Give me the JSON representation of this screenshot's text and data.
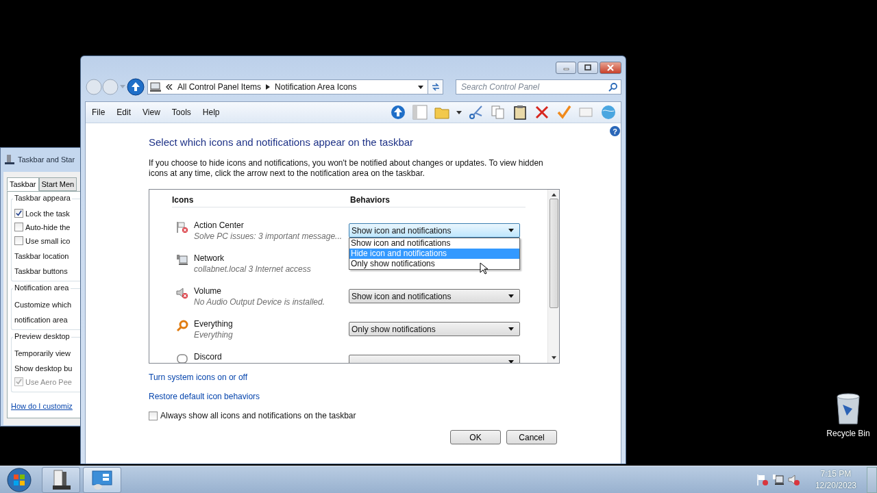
{
  "background_window": {
    "title": "Taskbar and Star",
    "tabs": [
      {
        "label": "Taskbar",
        "selected": true
      },
      {
        "label": "Start Men",
        "selected": false
      }
    ],
    "groups": [
      {
        "title": "Taskbar appeara",
        "items": [
          {
            "kind": "checkbox",
            "label": "Lock the task",
            "checked": true,
            "disabled": false
          },
          {
            "kind": "checkbox",
            "label": "Auto-hide the",
            "checked": false,
            "disabled": false
          },
          {
            "kind": "checkbox",
            "label": "Use small ico",
            "checked": false,
            "disabled": false
          },
          {
            "kind": "text",
            "label": "Taskbar location"
          },
          {
            "kind": "text",
            "label": "Taskbar buttons"
          }
        ]
      },
      {
        "title": "Notification area",
        "items": [
          {
            "kind": "text",
            "label": "Customize which"
          },
          {
            "kind": "text",
            "label": "notification area"
          }
        ]
      },
      {
        "title": "Preview desktop",
        "items": [
          {
            "kind": "text",
            "label": "Temporarily view"
          },
          {
            "kind": "text",
            "label": "Show desktop bu"
          },
          {
            "kind": "checkbox",
            "label": "Use Aero Pee",
            "checked": true,
            "disabled": true
          }
        ]
      }
    ],
    "link": "How do I customiz"
  },
  "window": {
    "breadcrumb": [
      "All Control Panel Items",
      "Notification Area Icons"
    ],
    "search": {
      "placeholder": "Search Control Panel"
    },
    "menu": [
      "File",
      "Edit",
      "View",
      "Tools",
      "Help"
    ],
    "help": "?",
    "heading": "Select which icons and notifications appear on the taskbar",
    "description": "If you choose to hide icons and notifications, you won't be notified about changes or updates. To view hidden icons at any time, click the arrow next to the notification area on the taskbar.",
    "table": {
      "columns": [
        "Icons",
        "Behaviors"
      ],
      "rows": [
        {
          "kind": "flag",
          "name": "Action Center",
          "detail": "Solve PC issues: 3 important message...",
          "behavior": "Show icon and notifications",
          "expanded": true,
          "options": [
            {
              "label": "Show icon and notifications",
              "selected": false
            },
            {
              "label": "Hide icon and notifications",
              "selected": true
            },
            {
              "label": "Only show notifications",
              "selected": false
            }
          ]
        },
        {
          "kind": "network",
          "name": "Network",
          "detail": "collabnet.local  3 Internet access",
          "expanded": false
        },
        {
          "kind": "speaker",
          "name": "Volume",
          "detail": "No Audio Output Device is installed.",
          "behavior": "Show icon and notifications",
          "expanded": false
        },
        {
          "kind": "magnifier",
          "name": "Everything",
          "detail": "Everything",
          "behavior": "Only show notifications",
          "expanded": false
        },
        {
          "kind": "chat",
          "name": "Discord",
          "expanded": false
        }
      ]
    },
    "links": [
      "Turn system icons on or off",
      "Restore default icon behaviors"
    ],
    "always_show": {
      "label": "Always show all icons and notifications on the taskbar",
      "checked": false
    },
    "buttons": [
      "OK",
      "Cancel"
    ]
  },
  "desktop_icons": [
    "Recycle Bin"
  ],
  "taskbar": {
    "time": "7:15 PM",
    "date": "12/20/2023"
  }
}
